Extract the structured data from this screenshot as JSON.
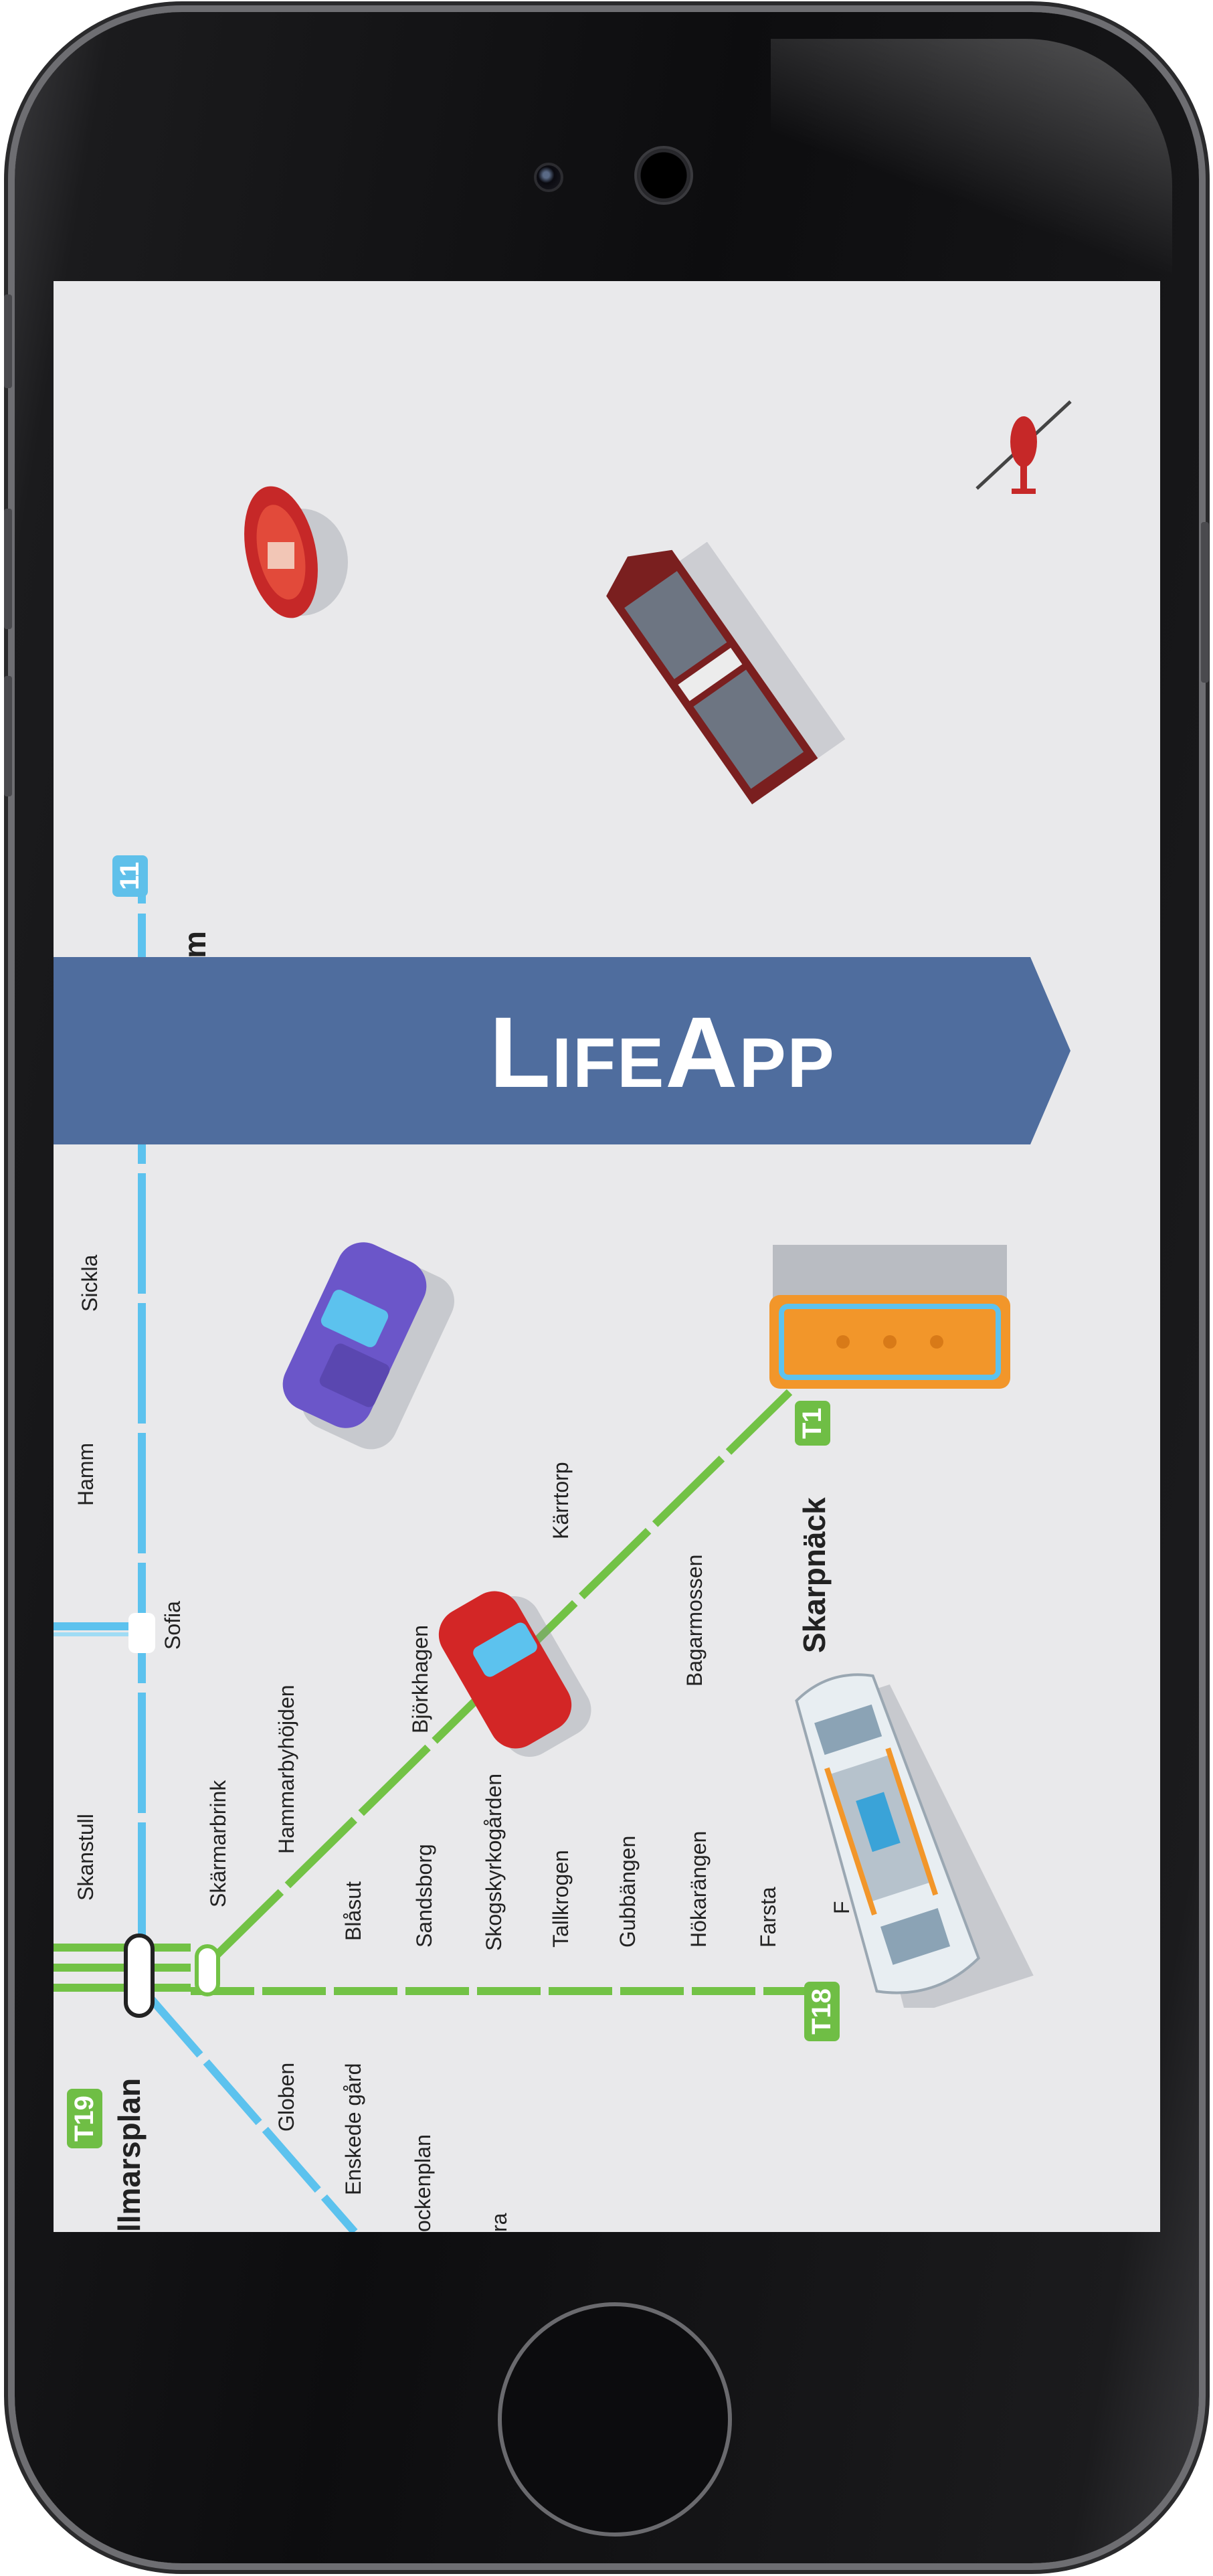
{
  "app": {
    "title": "LifeApp"
  },
  "colors": {
    "banner": "#4f6d9e",
    "green_line": "#72c245",
    "blue_line": "#5cc2ee",
    "screen_bg": "#e9e9eb"
  },
  "lines": {
    "t19": "T19",
    "t18": "T18",
    "t17": "T1",
    "t11": "11"
  },
  "stations": {
    "gullmarsplan": "llmarsplan",
    "skanstull": "Skanstull",
    "globen": "Globen",
    "enskede_gard": "Enskede gård",
    "sockenplan": "ockenplan",
    "ra": "ra",
    "skarmarbrink": "Skärmarbrink",
    "hammarbyhojden": "Hammarbyhöjden",
    "blasut": "Blåsut",
    "bjorkhagen": "Björkhagen",
    "sandsborg": "Sandsborg",
    "skogskyrkogarden": "Skogskyrkogården",
    "karrtorp": "Kärrtorp",
    "tallkrogen": "Tallkrogen",
    "gubbangen": "Gubbängen",
    "bagarmossen": "Bagarmossen",
    "hokarangen": "Hökarängen",
    "farsta": "Farsta",
    "f_cut": "F",
    "skarpnack": "Skarpnäck",
    "sofia": "Sofia",
    "hamm_cut": "Hamm",
    "sickla_cut": "Sickla",
    "um_cut": "um"
  },
  "icons": [
    "lifeboat-icon",
    "cargo-ship-icon",
    "helicopter-icon",
    "purple-car-icon",
    "red-car-icon",
    "orange-bus-icon",
    "cruise-ship-icon"
  ]
}
